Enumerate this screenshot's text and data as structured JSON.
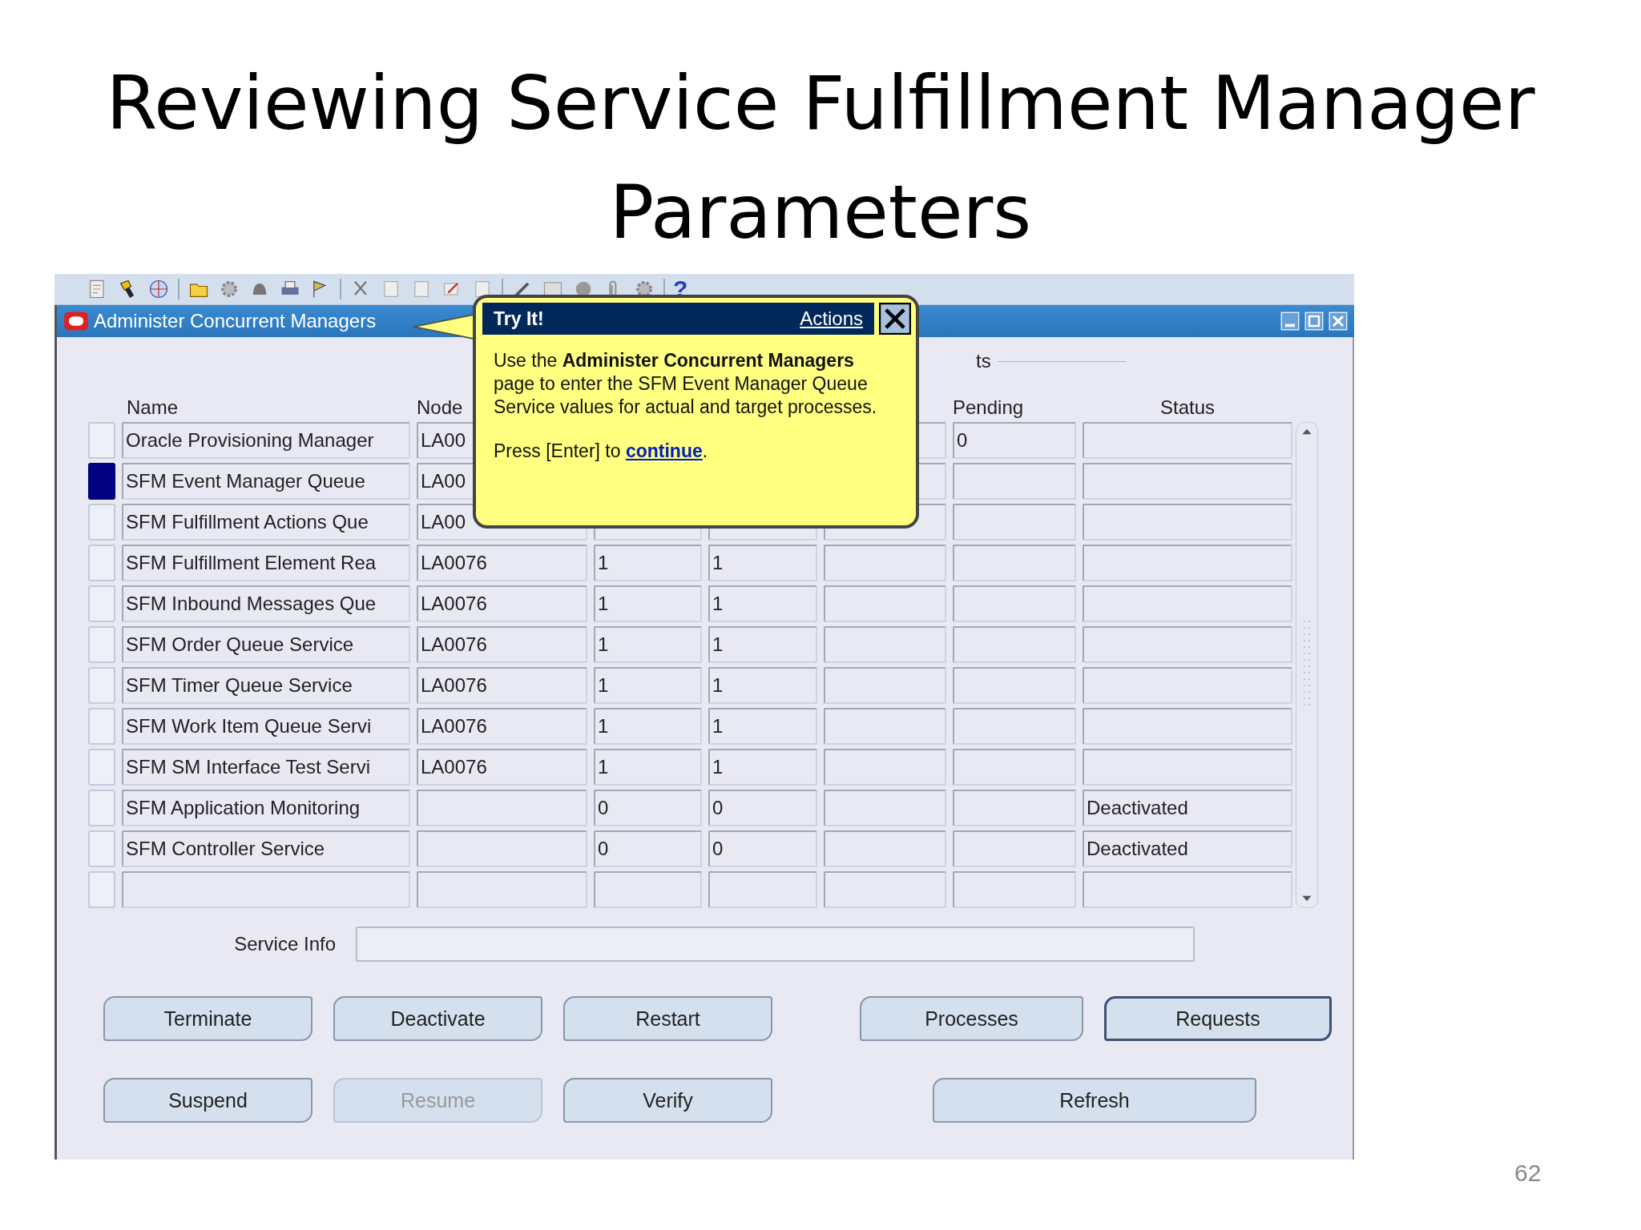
{
  "slide": {
    "title": "Reviewing Service Fulfillment Manager Parameters",
    "page_number": "62"
  },
  "toolbar": {
    "help_label": "?"
  },
  "window": {
    "title": "Administer Concurrent Managers"
  },
  "group_label": "ts",
  "columns": {
    "name": "Name",
    "node": "Node",
    "pending": "Pending",
    "status": "Status"
  },
  "rows": [
    {
      "selected": false,
      "name": "Oracle Provisioning Manager",
      "node": "LA00",
      "pending": "0"
    },
    {
      "selected": true,
      "name": "SFM Event Manager Queue",
      "node": "LA00"
    },
    {
      "selected": false,
      "name": "SFM Fulfillment Actions Que",
      "node": "LA00"
    },
    {
      "selected": false,
      "name": "SFM Fulfillment Element Rea",
      "node": "LA0076",
      "column_3": "1",
      "column_4": "1"
    },
    {
      "selected": false,
      "name": "SFM Inbound Messages Que",
      "node": "LA0076",
      "column_3": "1",
      "column_4": "1"
    },
    {
      "selected": false,
      "name": "SFM Order Queue Service",
      "node": "LA0076",
      "column_3": "1",
      "column_4": "1"
    },
    {
      "selected": false,
      "name": "SFM Timer Queue Service",
      "node": "LA0076",
      "column_3": "1",
      "column_4": "1"
    },
    {
      "selected": false,
      "name": "SFM Work Item Queue Servi",
      "node": "LA0076",
      "column_3": "1",
      "column_4": "1"
    },
    {
      "selected": false,
      "name": "SFM SM Interface Test Servi",
      "node": "LA0076",
      "column_3": "1",
      "column_4": "1"
    },
    {
      "selected": false,
      "name": "SFM Application Monitoring",
      "column_3": "0",
      "column_4": "0",
      "status": "Deactivated"
    },
    {
      "selected": false,
      "name": "SFM Controller Service",
      "column_3": "0",
      "column_4": "0",
      "status": "Deactivated"
    },
    {
      "selected": false
    }
  ],
  "service_info": {
    "label": "Service Info"
  },
  "button_rows": [
    {
      "buttons": [
        {
          "label": "Terminate",
          "disabled": false,
          "default": false
        },
        {
          "label": "Deactivate",
          "disabled": false,
          "default": false
        },
        {
          "label": "Restart",
          "disabled": false,
          "default": false
        },
        {
          "label": "Processes",
          "disabled": false,
          "default": false
        },
        {
          "label": "Requests",
          "disabled": false,
          "default": true
        }
      ]
    },
    {
      "buttons": [
        {
          "label": "Suspend",
          "disabled": false,
          "default": false
        },
        {
          "label": "Resume",
          "disabled": true,
          "default": false
        },
        {
          "label": "Verify",
          "disabled": false,
          "default": false
        },
        {
          "label": "Refresh",
          "disabled": false,
          "default": false
        }
      ]
    }
  ],
  "popup": {
    "title": "Try It!",
    "actions_link": "Actions",
    "message": "Use the **Administer Concurrent Managers** page to enter the SFM Event Manager Queue Service values for actual and target processes.",
    "prompt_before": "Press [Enter] to",
    "prompt_link": "continue",
    "prompt_after": "."
  }
}
